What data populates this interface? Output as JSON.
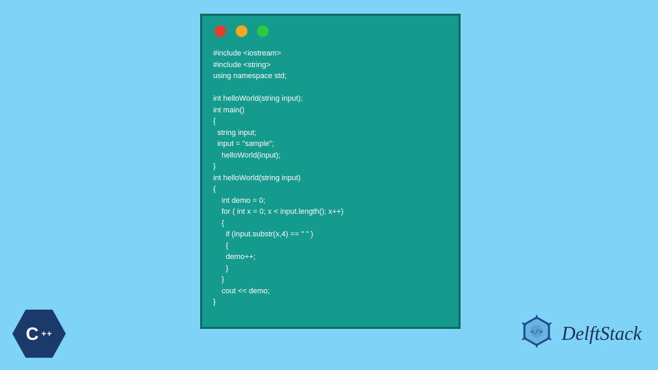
{
  "window": {
    "traffic_lights": {
      "red": "#e43e2b",
      "yellow": "#f5a623",
      "green": "#29c940"
    }
  },
  "code": "#include <iostream>\n#include <string>\nusing namespace std;\n\nint helloWorld(string input);\nint main()\n{\n  string input;\n  input = \"sample\";\n    helloWorld(input);\n}\nint helloWorld(string input)\n{\n    int demo = 0;\n    for ( int x = 0; x < input.length(); x++)\n    {\n      if (input.substr(x,4) == \" \" )\n      {\n      demo++;\n      }\n    }\n    cout << demo;\n}",
  "badges": {
    "cpp_label": "C",
    "cpp_plus": "++",
    "delft_text": "DelftStack"
  }
}
